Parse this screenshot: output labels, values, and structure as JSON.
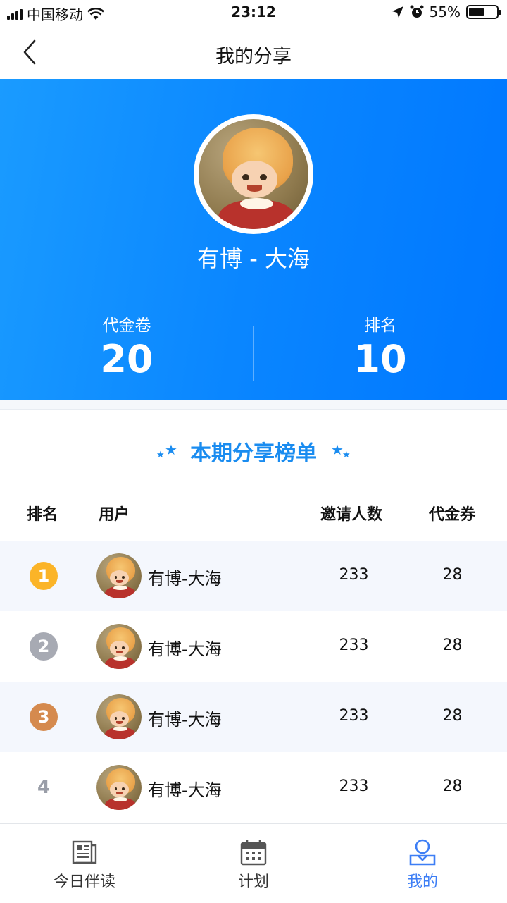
{
  "status_bar": {
    "carrier": "中国移动",
    "time": "23:12",
    "battery": "55%",
    "battery_level": 0.55
  },
  "nav": {
    "title": "我的分享"
  },
  "profile": {
    "name": "有博 - 大海",
    "stats": [
      {
        "label": "代金卷",
        "value": "20"
      },
      {
        "label": "排名",
        "value": "10"
      }
    ]
  },
  "ranking": {
    "title": "本期分享榜单",
    "headers": {
      "rank": "排名",
      "user": "用户",
      "invites": "邀请人数",
      "vouchers": "代金券"
    },
    "rows": [
      {
        "rank": "1",
        "name": "有博-大海",
        "invites": "233",
        "vouchers": "28"
      },
      {
        "rank": "2",
        "name": "有博-大海",
        "invites": "233",
        "vouchers": "28"
      },
      {
        "rank": "3",
        "name": "有博-大海",
        "invites": "233",
        "vouchers": "28"
      },
      {
        "rank": "4",
        "name": "有博-大海",
        "invites": "233",
        "vouchers": "28"
      }
    ]
  },
  "colors": {
    "accent": "#1a8cf0",
    "gold": "#fbb428",
    "silver": "#a7aab3",
    "bronze": "#d58a4e",
    "tab_active": "#3d7ef5"
  },
  "tabbar": {
    "items": [
      {
        "label": "今日伴读",
        "icon": "newspaper-icon"
      },
      {
        "label": "计划",
        "icon": "calendar-icon"
      },
      {
        "label": "我的",
        "icon": "profile-icon",
        "active": true
      }
    ]
  }
}
